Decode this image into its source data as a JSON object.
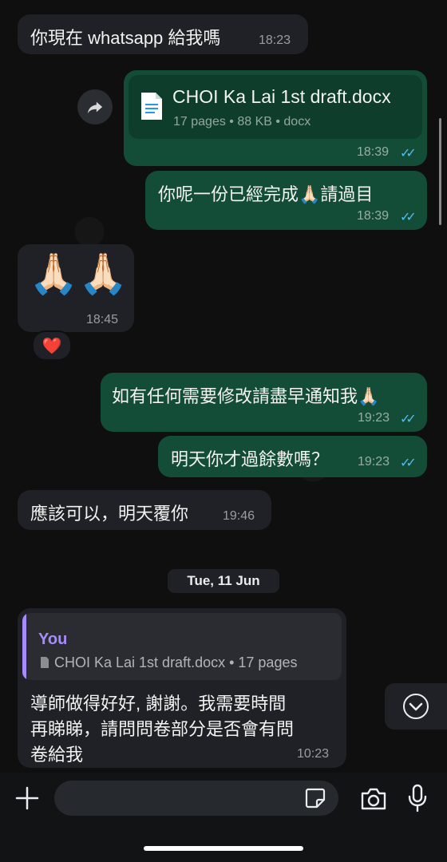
{
  "messages": [
    {
      "text": "你現在 whatsapp 給我嗎",
      "time": "18:23"
    },
    {
      "file_name": "CHOI Ka Lai 1st draft.docx",
      "file_meta": "17 pages • 88 KB • docx",
      "time": "18:39"
    },
    {
      "text": "你呢一份已經完成🙏🏻請過目",
      "time": "18:39"
    },
    {
      "text": "🙏🏻🙏🏻",
      "time": "18:45",
      "reaction": "❤️"
    },
    {
      "text": "如有任何需要修改請盡早通知我🙏🏻",
      "time": "19:23"
    },
    {
      "text": "明天你才過餘數嗎？",
      "time": "19:23"
    },
    {
      "text": "應該可以，明天覆你",
      "time": "19:46"
    }
  ],
  "date_divider": "Tue, 11 Jun",
  "quoted_message": {
    "sender": "You",
    "preview": "CHOI Ka Lai 1st draft.docx • 17 pages",
    "text_line1": "導師做得好好, 謝謝。我需要時間",
    "text_line2": "再睇睇，請問問卷部分是否會有問",
    "text_line3": "卷給我",
    "time": "10:23"
  },
  "read_ticks": "✓✓",
  "icons": {
    "forward": "forward-icon",
    "document": "document-icon",
    "scroll_down": "chevron-down-icon",
    "plus": "plus-icon",
    "sticker": "sticker-icon",
    "camera": "camera-icon",
    "mic": "microphone-icon"
  },
  "colors": {
    "outgoing": "#144d37",
    "incoming": "#1f2126",
    "read_tick": "#53bdeb",
    "quote_accent": "#a78bfa"
  }
}
